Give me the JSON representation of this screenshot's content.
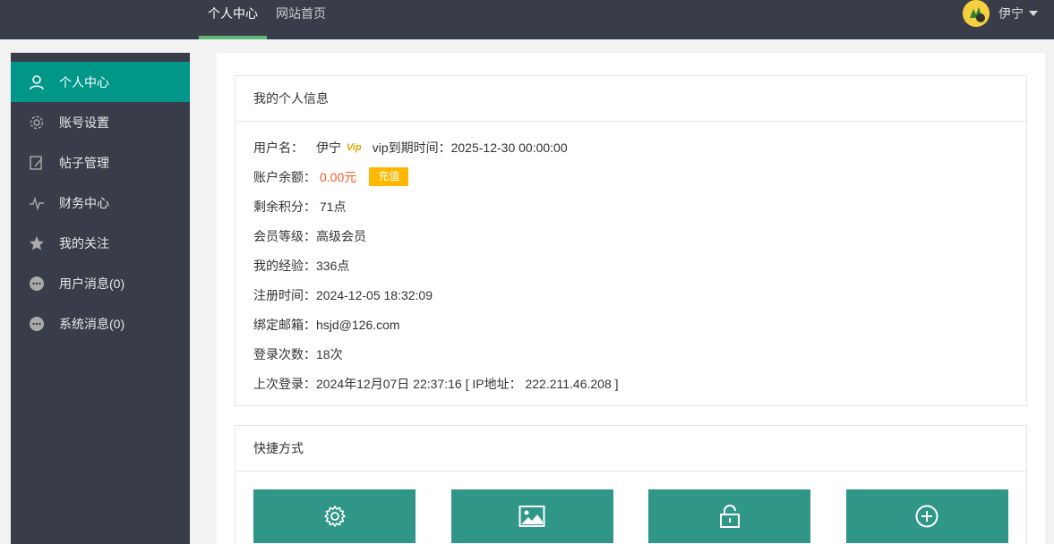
{
  "topnav": {
    "items": [
      {
        "label": "个人中心",
        "active": true
      },
      {
        "label": "网站首页",
        "active": false
      }
    ],
    "username": "伊宁"
  },
  "sidebar": {
    "items": [
      {
        "label": "个人中心",
        "icon": "user-icon"
      },
      {
        "label": "账号设置",
        "icon": "gear-icon"
      },
      {
        "label": "帖子管理",
        "icon": "edit-icon"
      },
      {
        "label": "财务中心",
        "icon": "pulse-icon"
      },
      {
        "label": "我的关注",
        "icon": "star-icon"
      },
      {
        "label": "用户消息(0)",
        "icon": "chat-icon"
      },
      {
        "label": "系统消息(0)",
        "icon": "chat-icon"
      }
    ]
  },
  "info": {
    "title": "我的个人信息",
    "username_label": "用户名：",
    "username": "伊宁",
    "vip_badge": "Vip",
    "vip_expire": "vip到期时间：2025-12-30 00:00:00",
    "balance_label": "账户余额：",
    "balance": "0.00元",
    "recharge": "充值",
    "points": "剩余积分： 71点",
    "level": "会员等级：高级会员",
    "exp": "我的经验：336点",
    "reg_time": "注册时间：2024-12-05 18:32:09",
    "email": "绑定邮箱：hsjd@126.com",
    "login_count": "登录次数：18次",
    "last_login": "上次登录：2024年12月07日 22:37:16 [ IP地址： 222.211.46.208 ]"
  },
  "shortcuts": {
    "title": "快捷方式",
    "buttons": [
      "gear-icon",
      "image-icon",
      "unlock-icon",
      "plus-circle-icon"
    ]
  },
  "colors": {
    "topbar": "#393d49",
    "active": "#009688",
    "accent_green": "#5fb878",
    "recharge": "#ffb800",
    "balance": "#ff5722",
    "shortcut": "#2f9688"
  }
}
